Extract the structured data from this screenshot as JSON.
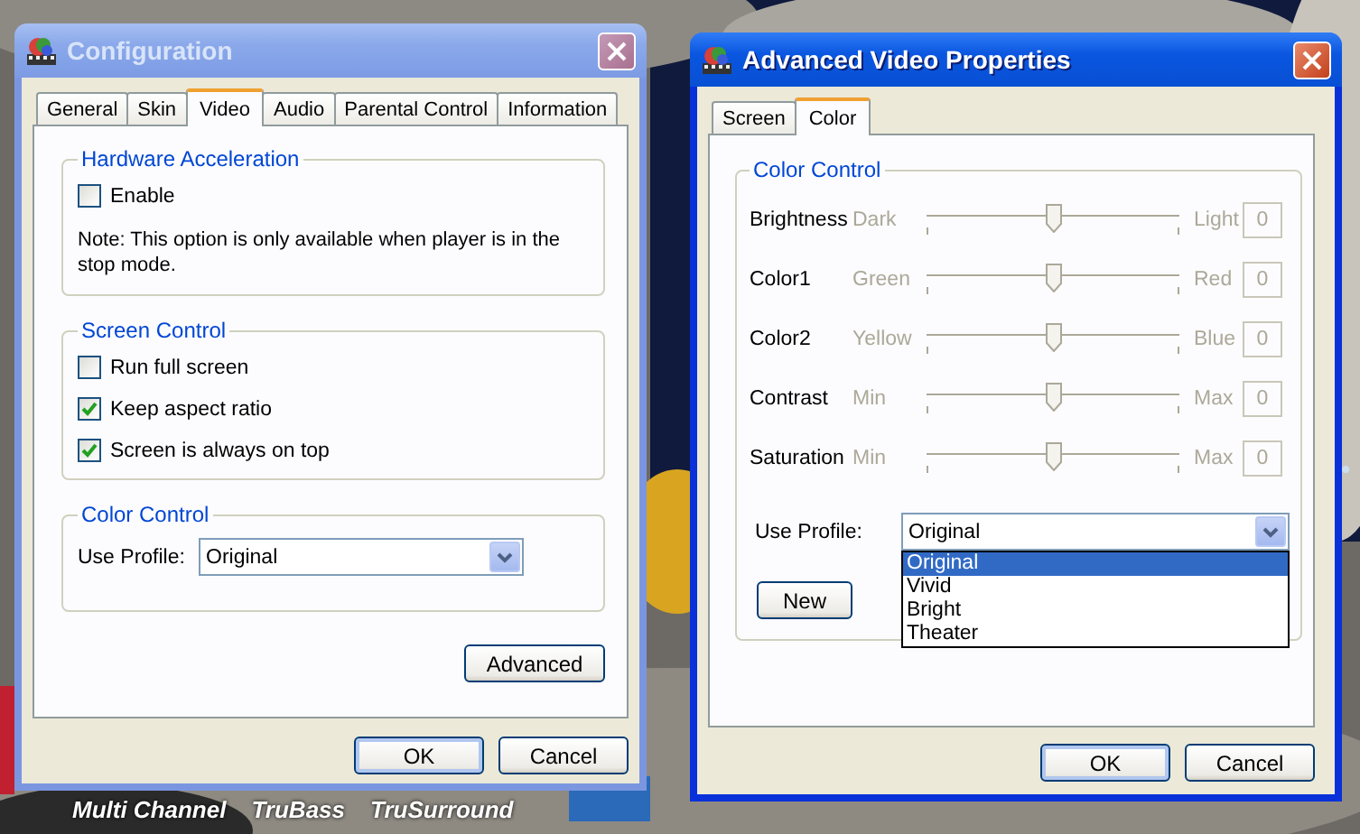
{
  "background": {
    "kind": "picture",
    "logos": [
      "Multi Channel",
      "TruBass",
      "TruSurround"
    ]
  },
  "config_window": {
    "title": "Configuration",
    "active": false,
    "tabs": [
      {
        "label": "General",
        "selected": false
      },
      {
        "label": "Skin",
        "selected": false
      },
      {
        "label": "Video",
        "selected": true
      },
      {
        "label": "Audio",
        "selected": false
      },
      {
        "label": "Parental Control",
        "selected": false
      },
      {
        "label": "Information",
        "selected": false
      }
    ],
    "hardware_acceleration": {
      "title": "Hardware Acceleration",
      "checkboxes": [
        {
          "label": "Enable",
          "checked": false
        }
      ],
      "note": "Note: This option is only available when player is in the stop mode."
    },
    "screen_control": {
      "title": "Screen Control",
      "checkboxes": [
        {
          "label": "Run full screen",
          "checked": false
        },
        {
          "label": "Keep aspect ratio",
          "checked": true
        },
        {
          "label": "Screen is always on top",
          "checked": true
        }
      ]
    },
    "color_control": {
      "title": "Color Control",
      "profile_label": "Use Profile:",
      "profile_value": "Original"
    },
    "advanced_button": "Advanced",
    "buttons": [
      "OK",
      "Cancel"
    ]
  },
  "advanced_window": {
    "title": "Advanced Video Properties",
    "active": true,
    "tabs": [
      {
        "label": "Screen",
        "selected": false
      },
      {
        "label": "Color",
        "selected": true
      }
    ],
    "group_title": "Color Control",
    "sliders": [
      {
        "name": "Brightness",
        "low": "Dark",
        "high": "Light",
        "level": 0.5,
        "reading": "0",
        "disabled": true
      },
      {
        "name": "Color1",
        "low": "Green",
        "high": "Red",
        "level": 0.5,
        "reading": "0",
        "disabled": true
      },
      {
        "name": "Color2",
        "low": "Yellow",
        "high": "Blue",
        "level": 0.5,
        "reading": "0",
        "disabled": true
      },
      {
        "name": "Contrast",
        "low": "Min",
        "high": "Max",
        "level": 0.5,
        "reading": "0",
        "disabled": true
      },
      {
        "name": "Saturation",
        "low": "Min",
        "high": "Max",
        "level": 0.5,
        "reading": "0",
        "disabled": true
      }
    ],
    "profile_label": "Use Profile:",
    "profile_value": "Original",
    "profile_options": [
      {
        "label": "Original",
        "selected": true
      },
      {
        "label": "Vivid",
        "selected": false
      },
      {
        "label": "Bright",
        "selected": false
      },
      {
        "label": "Theater",
        "selected": false
      }
    ],
    "new_button": "New",
    "buttons": [
      "OK",
      "Cancel"
    ]
  }
}
